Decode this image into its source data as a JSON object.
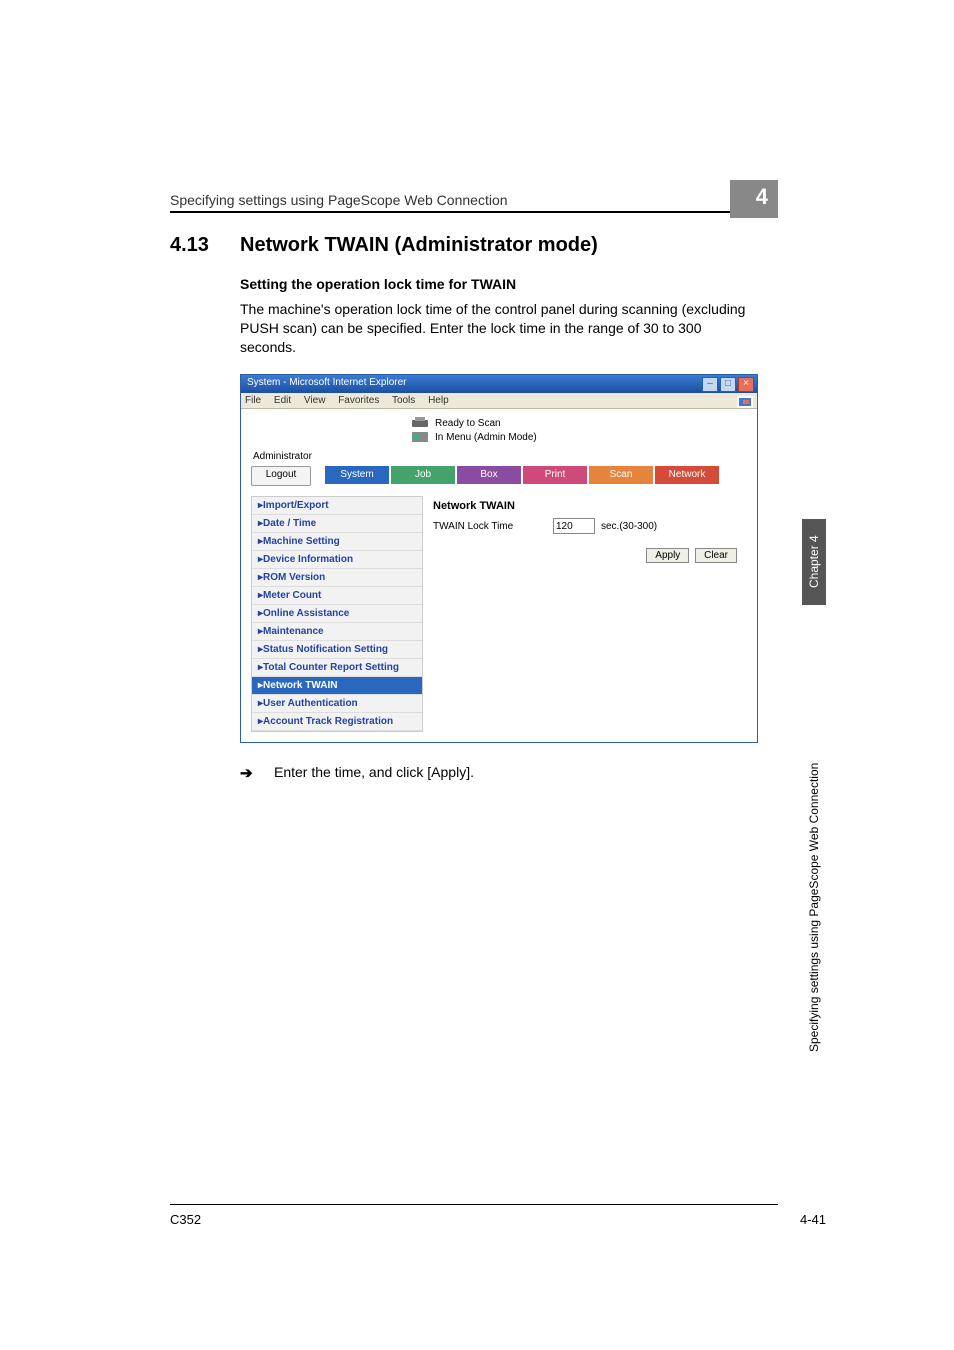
{
  "header": {
    "running_title": "Specifying settings using PageScope Web Connection",
    "chapter_badge": "4"
  },
  "section": {
    "number": "4.13",
    "title": "Network TWAIN (Administrator mode)",
    "subtitle": "Setting the operation lock time for TWAIN",
    "body": "The machine's operation lock time of the control panel during scanning (excluding PUSH scan) can be specified. Enter the lock time in the range of 30 to 300 seconds."
  },
  "ie": {
    "title": "System - Microsoft Internet Explorer",
    "menu": [
      "File",
      "Edit",
      "View",
      "Favorites",
      "Tools",
      "Help"
    ],
    "status1": "Ready to Scan",
    "status2": "In Menu (Admin Mode)",
    "admin_label": "Administrator",
    "logout": "Logout",
    "tabs": {
      "system": "System",
      "job": "Job",
      "box": "Box",
      "print": "Print",
      "scan": "Scan",
      "network": "Network"
    },
    "sidebar": [
      "Import/Export",
      "Date / Time",
      "Machine Setting",
      "Device Information",
      "ROM Version",
      "Meter Count",
      "Online Assistance",
      "Maintenance",
      "Status Notification Setting",
      "Total Counter Report Setting",
      "Network TWAIN",
      "User Authentication",
      "Account Track Registration"
    ],
    "sidebar_active_index": 10,
    "main": {
      "heading": "Network TWAIN",
      "lock_label": "TWAIN Lock Time",
      "lock_value": "120",
      "lock_unit": "sec.(30-300)",
      "apply": "Apply",
      "clear": "Clear"
    }
  },
  "instruction": {
    "arrow": "➔",
    "text": "Enter the time, and click [Apply]."
  },
  "side": {
    "tab": "Chapter 4",
    "text": "Specifying settings using PageScope Web Connection"
  },
  "footer": {
    "left": "C352",
    "right": "4-41"
  }
}
